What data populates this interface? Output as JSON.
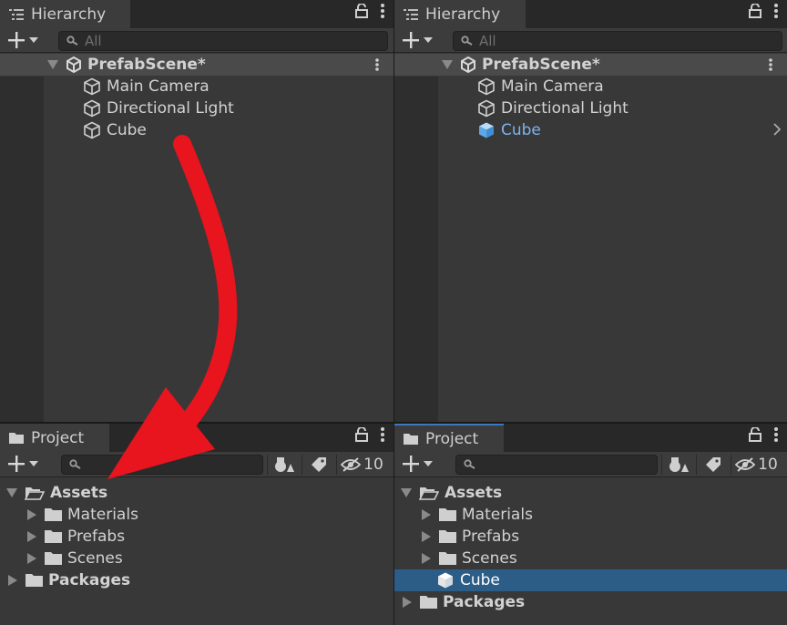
{
  "left": {
    "hierarchy": {
      "tab_label": "Hierarchy",
      "search_placeholder": "All",
      "scene_name": "PrefabScene*",
      "items": [
        {
          "label": "Main Camera"
        },
        {
          "label": "Directional Light"
        },
        {
          "label": "Cube"
        }
      ]
    },
    "project": {
      "tab_label": "Project",
      "hidden_count": "10",
      "tree": [
        {
          "label": "Assets"
        },
        {
          "label": "Materials"
        },
        {
          "label": "Prefabs"
        },
        {
          "label": "Scenes"
        },
        {
          "label": "Packages"
        }
      ]
    }
  },
  "right": {
    "hierarchy": {
      "tab_label": "Hierarchy",
      "search_placeholder": "All",
      "scene_name": "PrefabScene*",
      "items": [
        {
          "label": "Main Camera"
        },
        {
          "label": "Directional Light"
        },
        {
          "label": "Cube"
        }
      ]
    },
    "project": {
      "tab_label": "Project",
      "hidden_count": "10",
      "tree": [
        {
          "label": "Assets"
        },
        {
          "label": "Materials"
        },
        {
          "label": "Prefabs"
        },
        {
          "label": "Scenes"
        },
        {
          "label": "Cube"
        },
        {
          "label": "Packages"
        }
      ]
    }
  },
  "colors": {
    "selection": "#2c5d87",
    "prefab_text": "#7cb4f0",
    "arrow": "#e8141e"
  }
}
